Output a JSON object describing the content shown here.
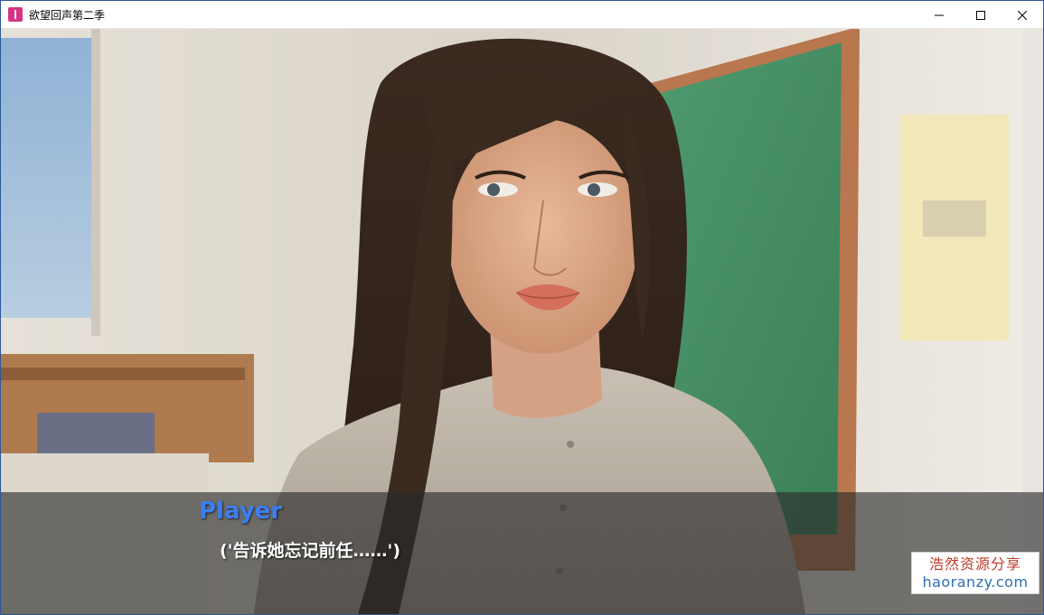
{
  "window": {
    "title": "欲望回声第二季",
    "controls": {
      "minimize_icon": "minimize-icon",
      "maximize_icon": "maximize-icon",
      "close_icon": "close-icon"
    }
  },
  "dialogue": {
    "speaker": "Player",
    "text": "('告诉她忘记前任……')"
  },
  "watermark": {
    "line1": "浩然资源分享",
    "line2": "haoranzy.com"
  },
  "colors": {
    "speaker": "#3d7ef0",
    "dialogue_text": "#ffffff",
    "watermark_cn": "#c0392b",
    "watermark_en": "#2f6fb5"
  }
}
